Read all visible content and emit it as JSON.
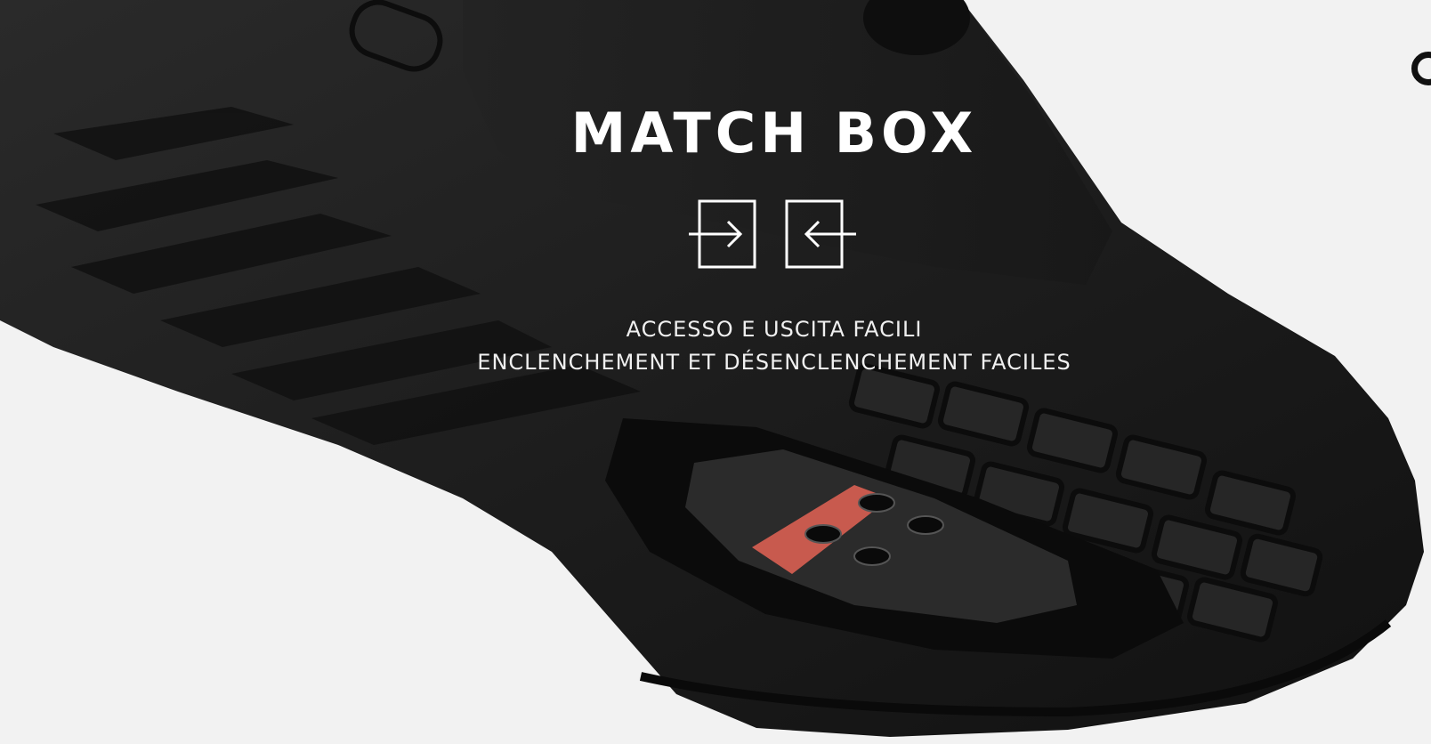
{
  "hero": {
    "title": "MATCH BOX",
    "caption_line_1": "ACCESSO E USCITA FACILI",
    "caption_line_2": "ENCLENCHEMENT ET DÉSENCLENCHEMENT FACILES"
  },
  "icons": {
    "enter": "enter-arrow-icon",
    "exit": "exit-arrow-icon",
    "edge_control": "carousel-control-icon"
  },
  "colors": {
    "background": "#f2f2f2",
    "shoe": "#1c1c1c",
    "accent_red": "#c85a4e",
    "text": "#ffffff"
  }
}
